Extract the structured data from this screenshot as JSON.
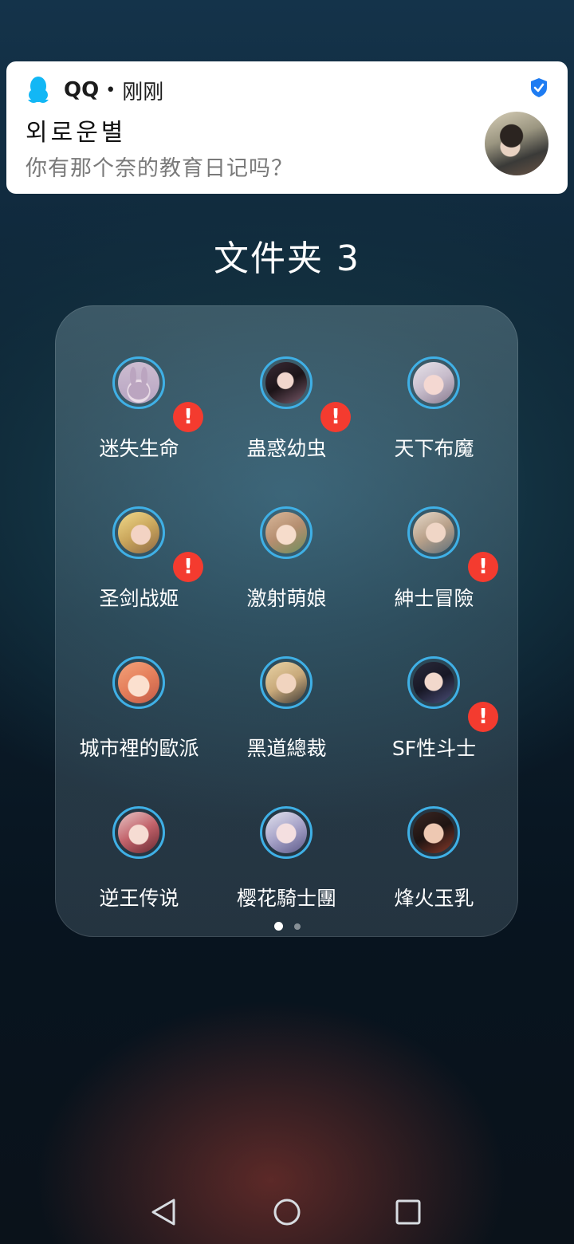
{
  "notification": {
    "app_name": "QQ",
    "separator": "•",
    "time": "刚刚",
    "sender": "외로운별",
    "message": "你有那个奈的教育日记吗？",
    "icon": "qq-penguin-icon",
    "badge_icon": "verified-shield-icon"
  },
  "folder": {
    "title": "文件夹 3",
    "apps": [
      {
        "label": "迷失生命",
        "badge": "!"
      },
      {
        "label": "蛊惑幼虫",
        "badge": "!"
      },
      {
        "label": "天下布魔",
        "badge": ""
      },
      {
        "label": "圣剑战姬",
        "badge": "!"
      },
      {
        "label": "激射萌娘",
        "badge": ""
      },
      {
        "label": "紳士冒險",
        "badge": "!"
      },
      {
        "label": "城市裡的歐派",
        "badge": ""
      },
      {
        "label": "黑道總裁",
        "badge": ""
      },
      {
        "label": "SF性斗士",
        "badge": "!"
      },
      {
        "label": "逆王传说",
        "badge": ""
      },
      {
        "label": "樱花騎士團",
        "badge": ""
      },
      {
        "label": "烽火玉乳",
        "badge": ""
      }
    ],
    "page_indicator": {
      "current": 1,
      "total": 2
    }
  },
  "navigation": {
    "back": "back-icon",
    "home": "home-icon",
    "recents": "recents-icon"
  },
  "colors": {
    "badge": "#f43b2f",
    "icon_ring": "#3fb0e6",
    "qq_blue": "#12b7f5",
    "verified_blue": "#1e7cf2"
  }
}
